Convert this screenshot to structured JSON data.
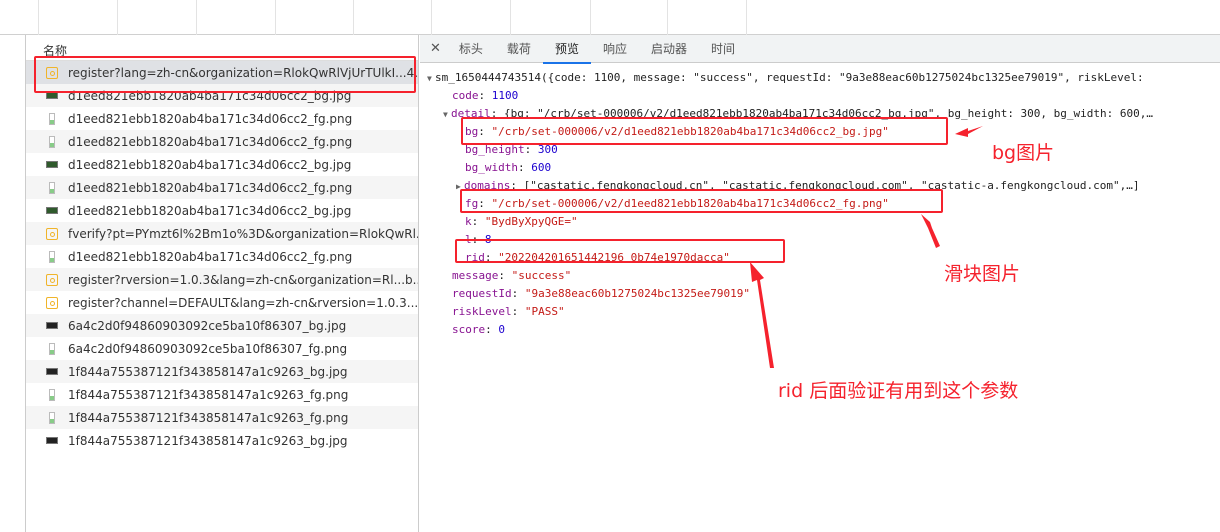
{
  "network": {
    "name_header": "名称",
    "rows": [
      {
        "name": "register?lang=zh-cn&organization=RlokQwRlVjUrTUlkI...4...",
        "type": "doc"
      },
      {
        "name": "d1eed821ebb1820ab4ba171c34d06cc2_bg.jpg",
        "type": "img"
      },
      {
        "name": "d1eed821ebb1820ab4ba171c34d06cc2_fg.png",
        "type": "png"
      },
      {
        "name": "d1eed821ebb1820ab4ba171c34d06cc2_fg.png",
        "type": "png"
      },
      {
        "name": "d1eed821ebb1820ab4ba171c34d06cc2_bg.jpg",
        "type": "img"
      },
      {
        "name": "d1eed821ebb1820ab4ba171c34d06cc2_fg.png",
        "type": "png"
      },
      {
        "name": "d1eed821ebb1820ab4ba171c34d06cc2_bg.jpg",
        "type": "img"
      },
      {
        "name": "fverify?pt=PYmzt6l%2Bm1o%3D&organization=RlokQwRl...",
        "type": "doc"
      },
      {
        "name": "d1eed821ebb1820ab4ba171c34d06cc2_fg.png",
        "type": "png"
      },
      {
        "name": "register?rversion=1.0.3&lang=zh-cn&organization=Rl...b...",
        "type": "doc"
      },
      {
        "name": "register?channel=DEFAULT&lang=zh-cn&rversion=1.0.3......",
        "type": "doc"
      },
      {
        "name": "6a4c2d0f94860903092ce5ba10f86307_bg.jpg",
        "type": "imgd"
      },
      {
        "name": "6a4c2d0f94860903092ce5ba10f86307_fg.png",
        "type": "png"
      },
      {
        "name": "1f844a755387121f343858147a1c9263_bg.jpg",
        "type": "imgd"
      },
      {
        "name": "1f844a755387121f343858147a1c9263_fg.png",
        "type": "png"
      },
      {
        "name": "1f844a755387121f343858147a1c9263_fg.png",
        "type": "png"
      },
      {
        "name": "1f844a755387121f343858147a1c9263_bg.jpg",
        "type": "imgd"
      }
    ]
  },
  "tabs": [
    "标头",
    "载荷",
    "预览",
    "响应",
    "启动器",
    "时间"
  ],
  "active_tab": "预览",
  "preview": {
    "root": "sm_1650444743514({code: 1100, message: \"success\", requestId: \"9a3e88eac60b1275024bc1325ee79019\", riskLevel:",
    "code": "1100",
    "detail_summary": "{bg: \"/crb/set-000006/v2/d1eed821ebb1820ab4ba171c34d06cc2_bg.jpg\", bg_height: 300, bg_width: 600,…",
    "bg": "\"/crb/set-000006/v2/d1eed821ebb1820ab4ba171c34d06cc2_bg.jpg\"",
    "bg_height": "300",
    "bg_width": "600",
    "domains": "[\"castatic.fengkongcloud.cn\", \"castatic.fengkongcloud.com\", \"castatic-a.fengkongcloud.com\",…]",
    "fg": "\"/crb/set-000006/v2/d1eed821ebb1820ab4ba171c34d06cc2_fg.png\"",
    "k": "\"BydByXpyQGE=\"",
    "l": "8",
    "rid": "\"202204201651442196 0b74e1970dacca\"",
    "message": "\"success\"",
    "requestId": "\"9a3e88eac60b1275024bc1325ee79019\"",
    "riskLevel": "\"PASS\"",
    "score": "0"
  },
  "annotations": {
    "bg_note": "bg图片",
    "fg_note": "滑块图片",
    "rid_note": "rid 后面验证有用到这个参数",
    "color": "#f5222d"
  }
}
